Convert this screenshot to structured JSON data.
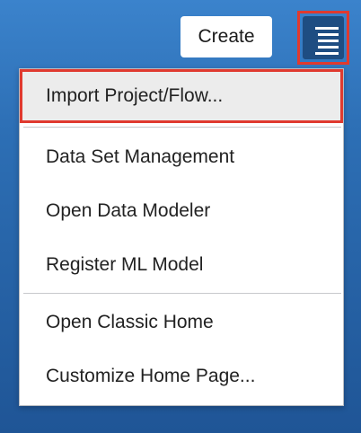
{
  "header": {
    "create_label": "Create",
    "menu_icon": "hamburger-menu-icon"
  },
  "menu": {
    "items": [
      {
        "label": "Import Project/Flow..."
      },
      {
        "label": "Data Set Management"
      },
      {
        "label": "Open Data Modeler"
      },
      {
        "label": "Register ML Model"
      },
      {
        "label": "Open Classic Home"
      },
      {
        "label": "Customize Home Page..."
      }
    ]
  },
  "colors": {
    "background": "#2d6fb5",
    "menu_button": "#1e4d82",
    "highlight_border": "#e03a2f",
    "highlight_bg": "#ececec"
  }
}
